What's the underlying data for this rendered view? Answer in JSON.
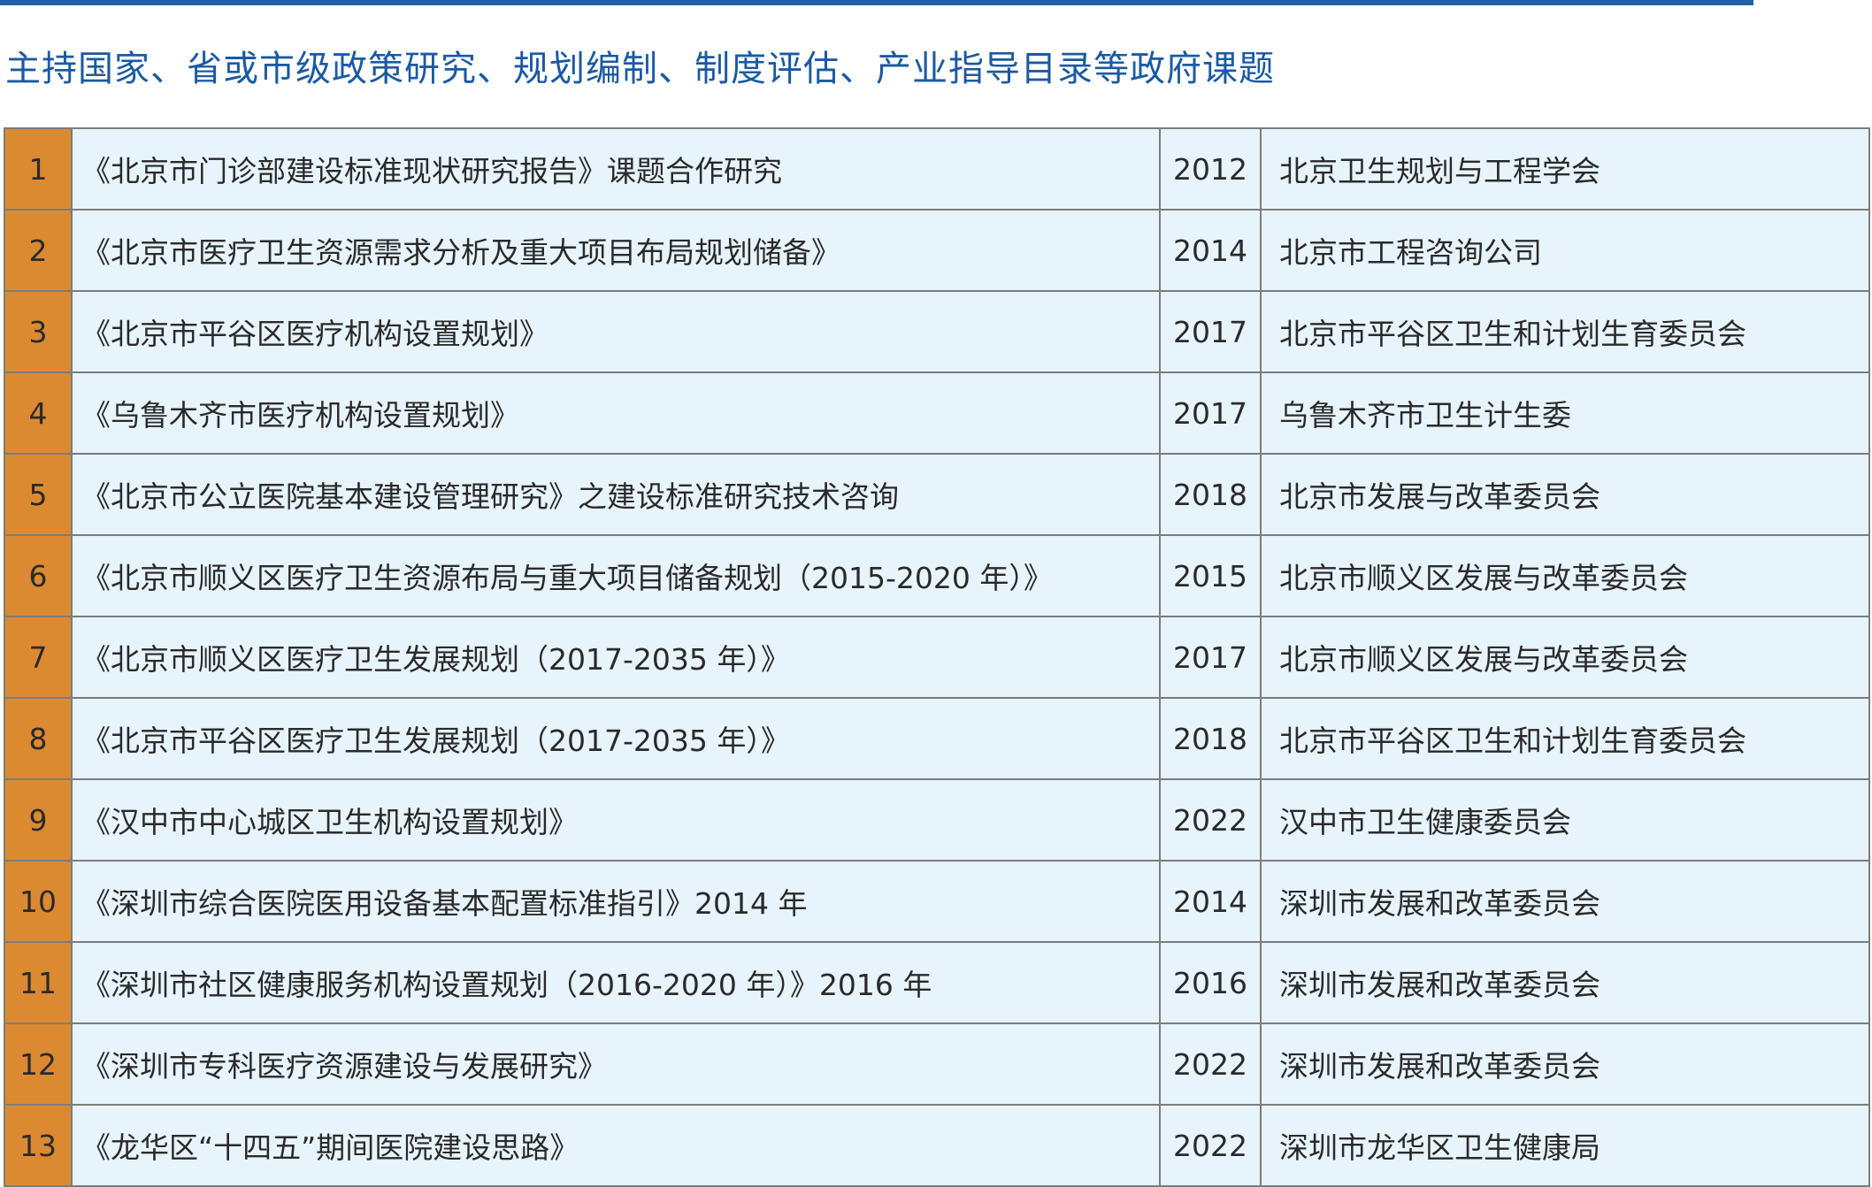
{
  "title": "主持国家、省或市级政策研究、规划编制、制度评估、产业指导目录等政府课题",
  "colors": {
    "title": "#1b5aa3",
    "rule": "#1f5fa6",
    "number_cell": "#dc8a32",
    "row_bg": "#e7f4fc",
    "border": "#7c7c7c"
  },
  "rows": [
    {
      "no": "1",
      "name": "《北京市门诊部建设标准现状研究报告》课题合作研究",
      "year": "2012",
      "org": "北京卫生规划与工程学会"
    },
    {
      "no": "2",
      "name": "《北京市医疗卫生资源需求分析及重大项目布局规划储备》",
      "year": "2014",
      "org": "北京市工程咨询公司"
    },
    {
      "no": "3",
      "name": "《北京市平谷区医疗机构设置规划》",
      "year": "2017",
      "org": "北京市平谷区卫生和计划生育委员会"
    },
    {
      "no": "4",
      "name": "《乌鲁木齐市医疗机构设置规划》",
      "year": "2017",
      "org": "乌鲁木齐市卫生计生委"
    },
    {
      "no": "5",
      "name": "《北京市公立医院基本建设管理研究》之建设标准研究技术咨询",
      "year": "2018",
      "org": "北京市发展与改革委员会"
    },
    {
      "no": "6",
      "name": "《北京市顺义区医疗卫生资源布局与重大项目储备规划（2015-2020 年）》",
      "year": "2015",
      "org": "北京市顺义区发展与改革委员会"
    },
    {
      "no": "7",
      "name": "《北京市顺义区医疗卫生发展规划（2017-2035 年）》",
      "year": "2017",
      "org": "北京市顺义区发展与改革委员会"
    },
    {
      "no": "8",
      "name": "《北京市平谷区医疗卫生发展规划（2017-2035 年）》",
      "year": "2018",
      "org": "北京市平谷区卫生和计划生育委员会"
    },
    {
      "no": "9",
      "name": "《汉中市中心城区卫生机构设置规划》",
      "year": "2022",
      "org": "汉中市卫生健康委员会"
    },
    {
      "no": "10",
      "name": "《深圳市综合医院医用设备基本配置标准指引》2014 年",
      "year": "2014",
      "org": "深圳市发展和改革委员会"
    },
    {
      "no": "11",
      "name": "《深圳市社区健康服务机构设置规划（2016-2020 年）》2016 年",
      "year": "2016",
      "org": "深圳市发展和改革委员会"
    },
    {
      "no": "12",
      "name": "《深圳市专科医疗资源建设与发展研究》",
      "year": "2022",
      "org": "深圳市发展和改革委员会"
    },
    {
      "no": "13",
      "name": "《龙华区“十四五”期间医院建设思路》",
      "year": "2022",
      "org": "深圳市龙华区卫生健康局"
    }
  ]
}
